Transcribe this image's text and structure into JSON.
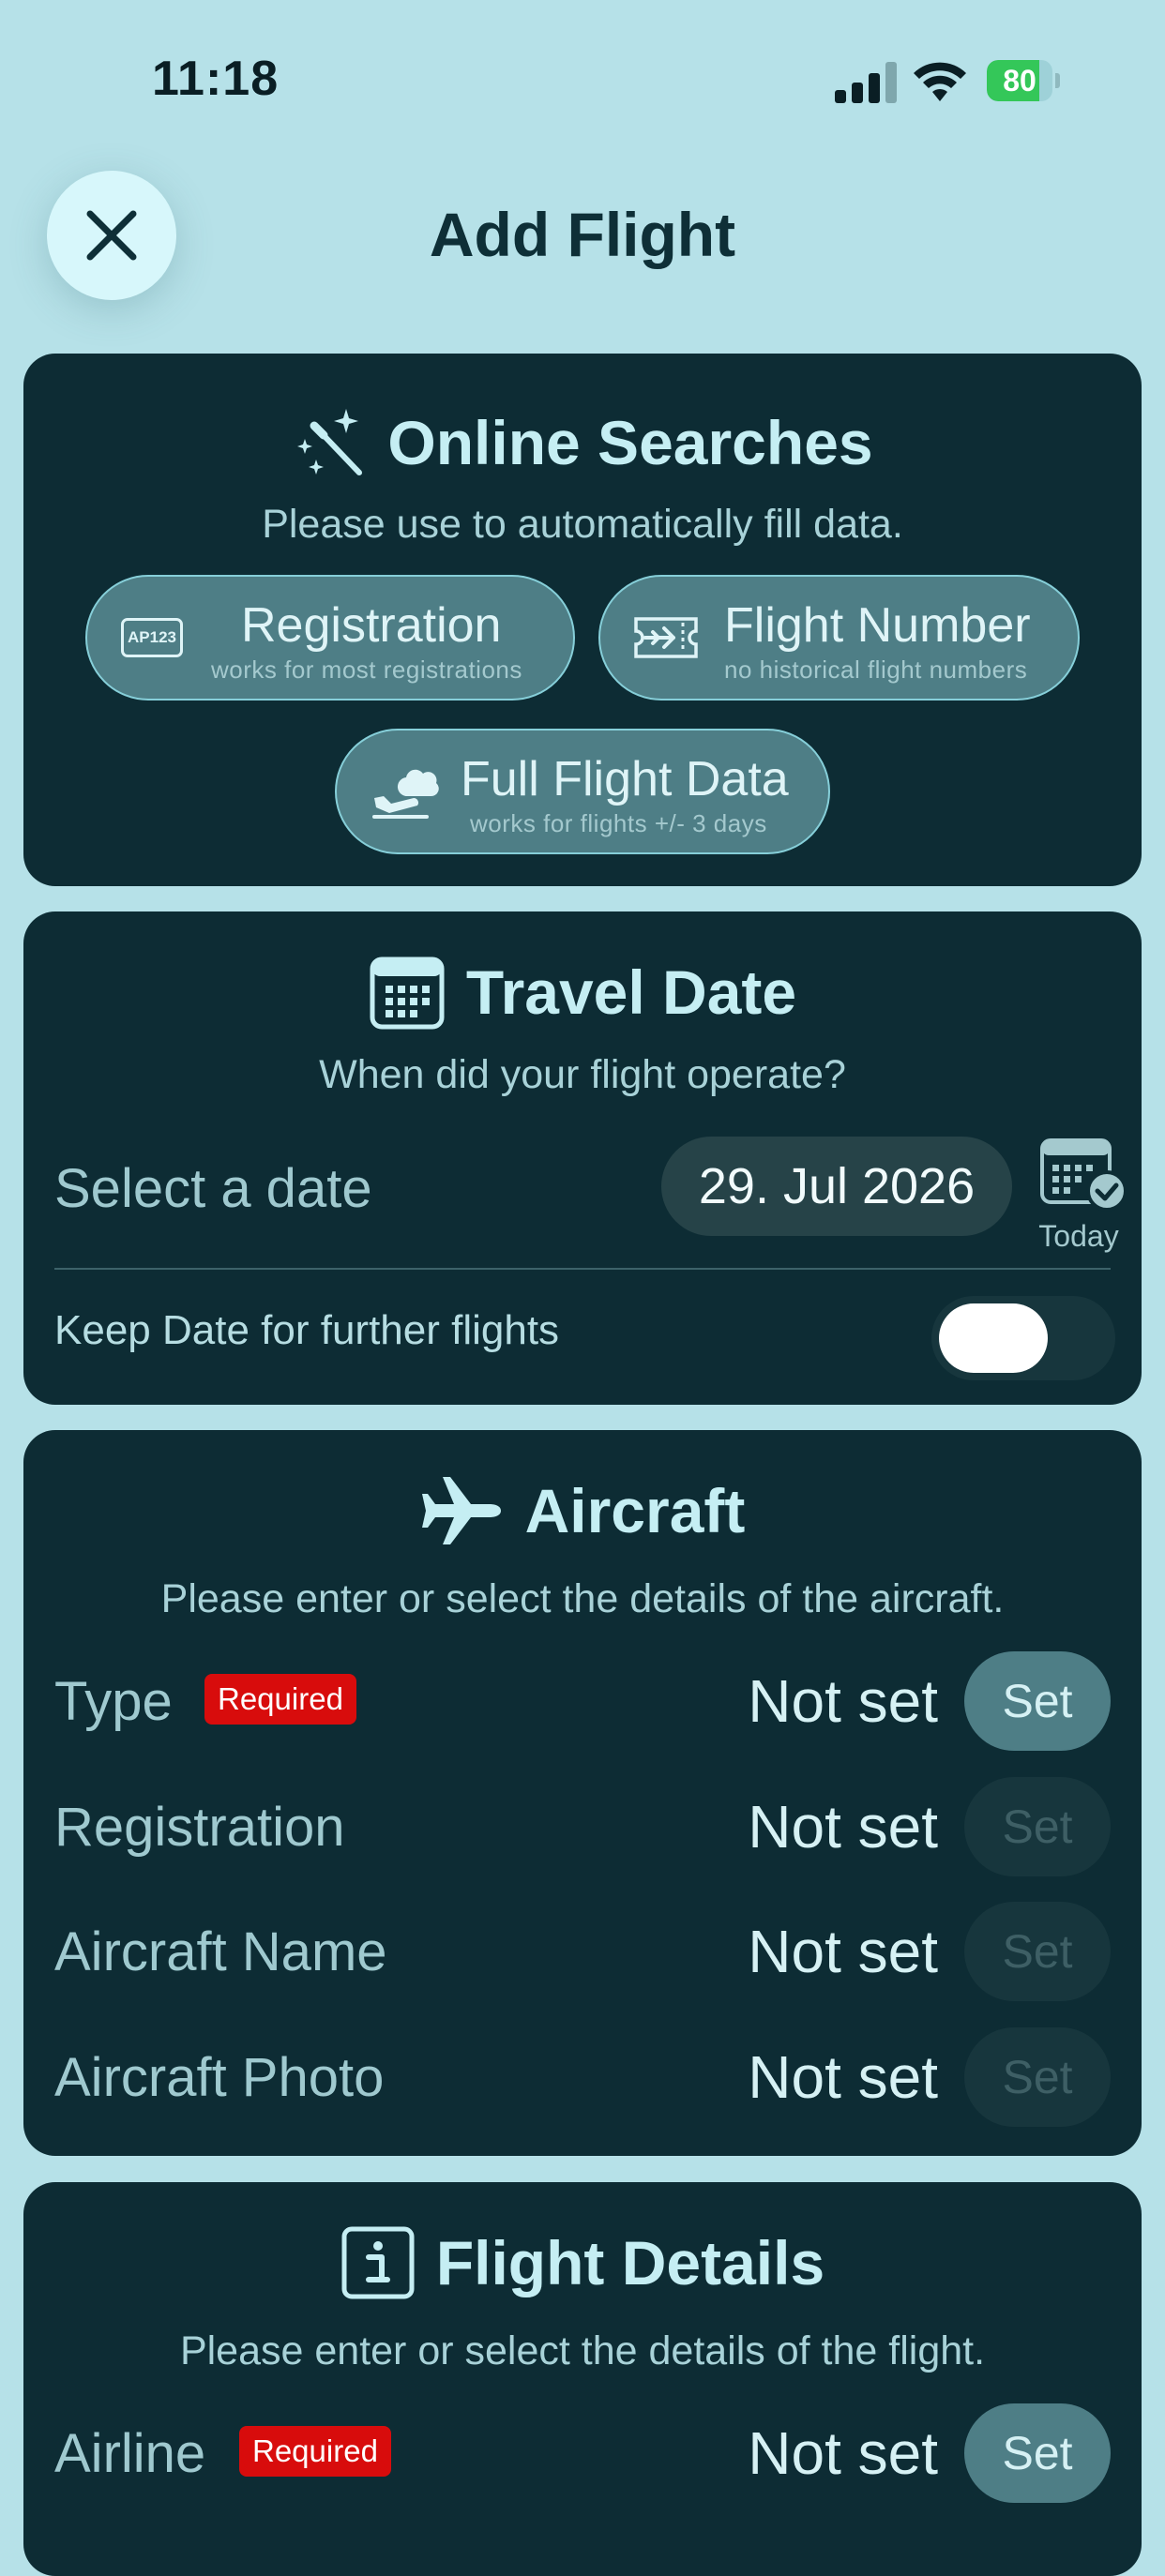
{
  "status_bar": {
    "time": "11:18",
    "battery": 80,
    "battery_label": "80"
  },
  "header": {
    "title": "Add Flight"
  },
  "online_searches": {
    "title": "Online Searches",
    "subtitle": "Please use to automatically fill data.",
    "buttons": [
      {
        "label": "Registration",
        "sub": "works for most registrations",
        "icon": "registration-plate-icon",
        "icon_text": "AP123"
      },
      {
        "label": "Flight Number",
        "sub": "no historical flight numbers",
        "icon": "ticket-icon"
      },
      {
        "label": "Full Flight Data",
        "sub": "works for flights +/- 3 days",
        "icon": "plane-cloud-icon"
      }
    ]
  },
  "travel_date": {
    "title": "Travel Date",
    "subtitle": "When did your flight operate?",
    "select_label": "Select a date",
    "date_value": "29. Jul 2026",
    "today_label": "Today",
    "keep_label": "Keep Date for further flights",
    "keep_enabled": false
  },
  "aircraft": {
    "title": "Aircraft",
    "subtitle": "Please enter or select the details of the aircraft.",
    "required_label": "Required",
    "rows": [
      {
        "label": "Type",
        "value": "Not set",
        "button": "Set",
        "required": true,
        "enabled": true
      },
      {
        "label": "Registration",
        "value": "Not set",
        "button": "Set",
        "required": false,
        "enabled": false
      },
      {
        "label": "Aircraft Name",
        "value": "Not set",
        "button": "Set",
        "required": false,
        "enabled": false
      },
      {
        "label": "Aircraft Photo",
        "value": "Not set",
        "button": "Set",
        "required": false,
        "enabled": false
      }
    ]
  },
  "flight_details": {
    "title": "Flight Details",
    "subtitle": "Please enter or select the details of the flight.",
    "required_label": "Required",
    "rows": [
      {
        "label": "Airline",
        "value": "Not set",
        "button": "Set",
        "required": true,
        "enabled": true
      }
    ]
  },
  "colors": {
    "background": "#b6e1e8",
    "card": "#0d2c34",
    "accent_button": "#4e7e86",
    "required_badge": "#d80c0c"
  }
}
